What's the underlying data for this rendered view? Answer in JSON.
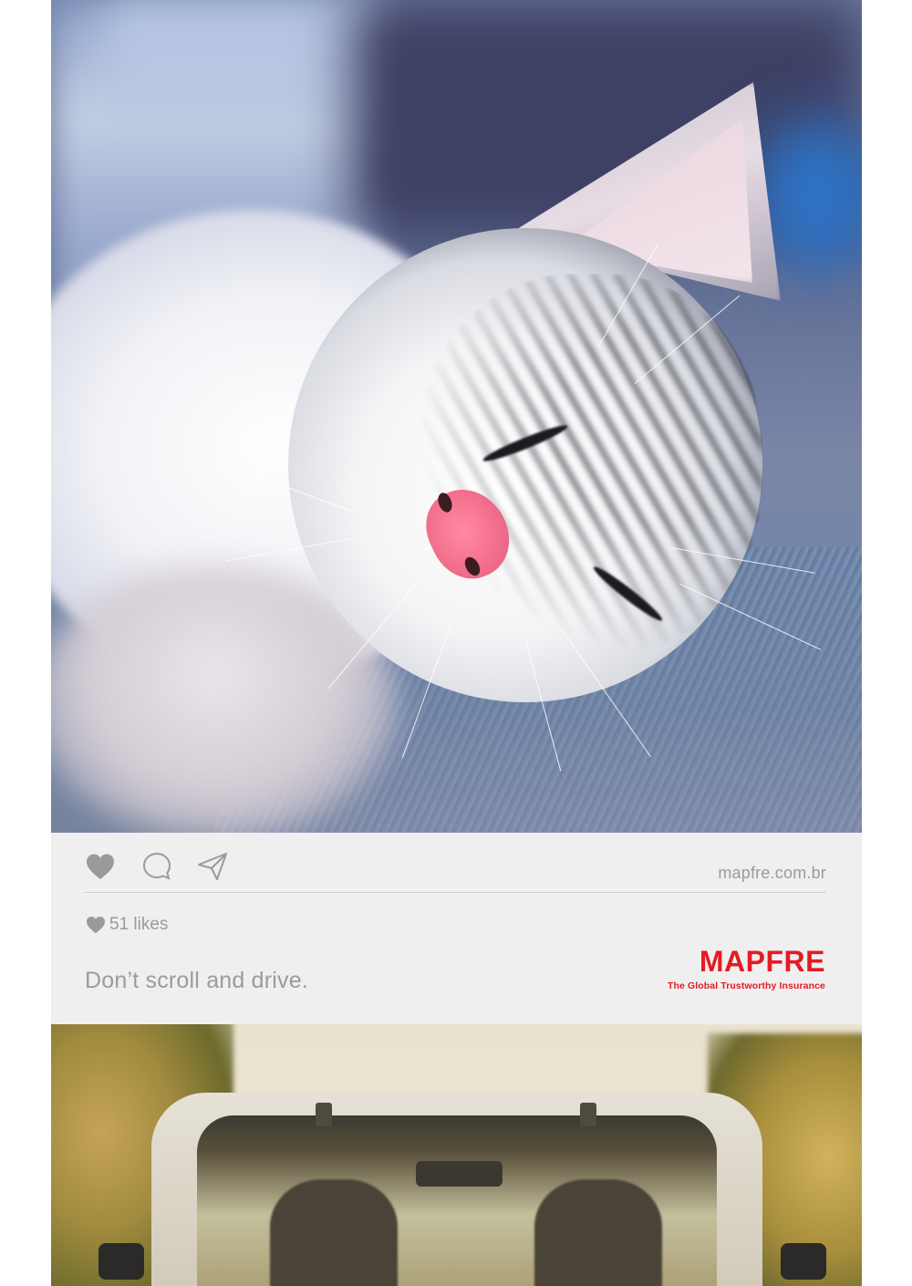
{
  "post": {
    "url": "mapfre.com.br",
    "likes": "51 likes",
    "caption": "Don’t scroll and drive."
  },
  "brand": {
    "logo": "MAPFRE",
    "tagline": "The Global Trustworthy Insurance",
    "color": "#e31b23"
  },
  "icons": {
    "like": "heart-icon",
    "comment": "comment-icon",
    "share": "send-icon",
    "likes_marker": "small-heart-icon"
  },
  "colors": {
    "ui_text": "#9b9b9b",
    "panel_background": "#efefef"
  }
}
